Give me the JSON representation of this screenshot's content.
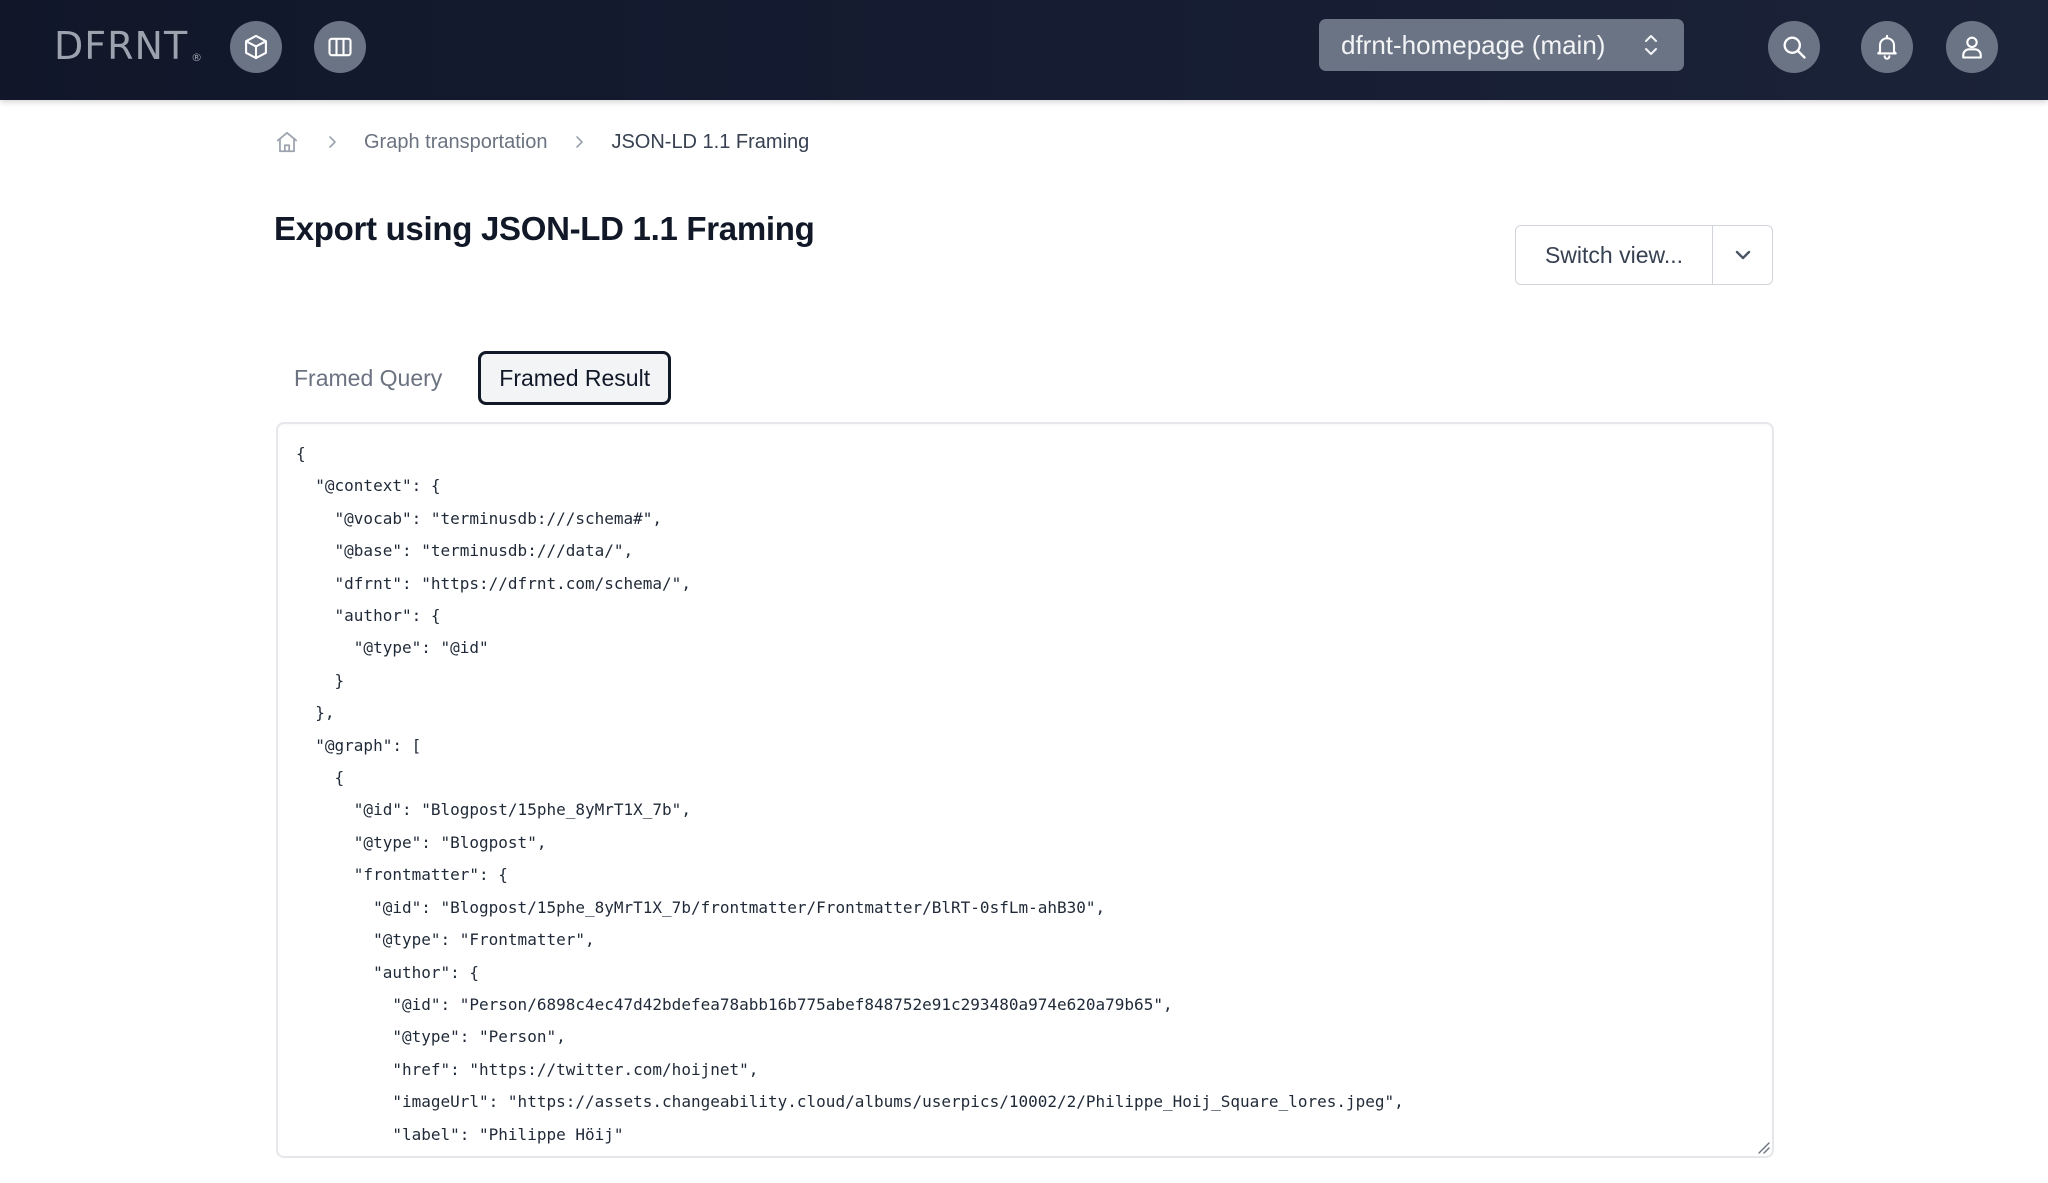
{
  "header": {
    "logo_text": "DFRNT",
    "logo_mark": "®",
    "left_icons": [
      "cube-icon",
      "columns-icon"
    ],
    "database_selector": {
      "value": "dfrnt-homepage (main)",
      "icon": "chevron-up-down-icon"
    },
    "right_icons": [
      "search-icon",
      "bell-icon",
      "user-icon"
    ]
  },
  "breadcrumb": {
    "home_icon": "home-icon",
    "items": [
      {
        "label": "Graph transportation"
      },
      {
        "label": "JSON-LD 1.1 Framing"
      }
    ]
  },
  "page": {
    "title": "Export using JSON-LD 1.1 Framing",
    "switch_view": {
      "label": "Switch view...",
      "icon": "chevron-down-icon"
    },
    "tabs": [
      {
        "label": "Framed Query",
        "active": false
      },
      {
        "label": "Framed Result",
        "active": true
      }
    ],
    "code_lines": [
      "{",
      "  \"@context\": {",
      "    \"@vocab\": \"terminusdb:///schema#\",",
      "    \"@base\": \"terminusdb:///data/\",",
      "    \"dfrnt\": \"https://dfrnt.com/schema/\",",
      "    \"author\": {",
      "      \"@type\": \"@id\"",
      "    }",
      "  },",
      "  \"@graph\": [",
      "    {",
      "      \"@id\": \"Blogpost/15phe_8yMrT1X_7b\",",
      "      \"@type\": \"Blogpost\",",
      "      \"frontmatter\": {",
      "        \"@id\": \"Blogpost/15phe_8yMrT1X_7b/frontmatter/Frontmatter/BlRT-0sfLm-ahB30\",",
      "        \"@type\": \"Frontmatter\",",
      "        \"author\": {",
      "          \"@id\": \"Person/6898c4ec47d42bdefea78abb16b775abef848752e91c293480a974e620a79b65\",",
      "          \"@type\": \"Person\",",
      "          \"href\": \"https://twitter.com/hoijnet\",",
      "          \"imageUrl\": \"https://assets.changeability.cloud/albums/userpics/10002/2/Philippe_Hoij_Square_lores.jpeg\",",
      "          \"label\": \"Philippe Höij\"",
      "        },"
    ]
  },
  "colors": {
    "header_bg": "#131a2e",
    "icon_button_bg": "#6b7485",
    "active_tab_border": "#111827"
  }
}
